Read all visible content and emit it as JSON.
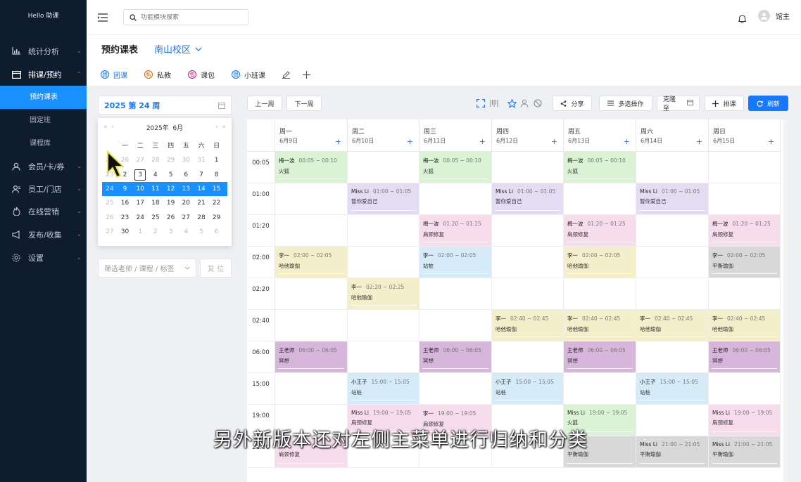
{
  "app": {
    "brand": "Hello 助课"
  },
  "sidebar": {
    "items": [
      {
        "label": "统计分析",
        "icon": "bar-chart-icon"
      },
      {
        "label": "排课/预约",
        "icon": "calendar-icon"
      },
      {
        "label": "会员/卡/券",
        "icon": "member-icon"
      },
      {
        "label": "员工/门店",
        "icon": "staff-icon"
      },
      {
        "label": "在线营销",
        "icon": "fire-icon"
      },
      {
        "label": "发布/收集",
        "icon": "megaphone-icon"
      },
      {
        "label": "设置",
        "icon": "settings-icon"
      }
    ],
    "subitems": [
      {
        "label": "预约课表"
      },
      {
        "label": "固定班"
      },
      {
        "label": "课程库"
      }
    ]
  },
  "header": {
    "search_placeholder": "功能模块搜索",
    "user_name": "馆主"
  },
  "page": {
    "title": "预约课表",
    "campus": "南山校区",
    "tabs": [
      {
        "label": "团课",
        "badge": "团",
        "color": "#1677ff"
      },
      {
        "label": "私教",
        "badge": "私",
        "color": "#d46b08"
      },
      {
        "label": "课包",
        "badge": "包",
        "color": "#c41d7f"
      },
      {
        "label": "小班课",
        "badge": "团",
        "color": "#1677ff"
      }
    ]
  },
  "week_picker": {
    "value": "2025 第 24 周",
    "year": "2025年",
    "month": "6月",
    "weekdays": [
      "一",
      "二",
      "三",
      "四",
      "五",
      "六",
      "日"
    ],
    "rows": [
      {
        "week": "22",
        "days": [
          "26",
          "27",
          "28",
          "29",
          "30",
          "31",
          "1"
        ]
      },
      {
        "week": "23",
        "days": [
          "2",
          "3",
          "4",
          "5",
          "6",
          "7",
          "8"
        ]
      },
      {
        "week": "24",
        "days": [
          "9",
          "10",
          "11",
          "12",
          "13",
          "14",
          "15"
        ]
      },
      {
        "week": "25",
        "days": [
          "16",
          "17",
          "18",
          "19",
          "20",
          "21",
          "22"
        ]
      },
      {
        "week": "26",
        "days": [
          "23",
          "24",
          "25",
          "26",
          "27",
          "28",
          "29"
        ]
      },
      {
        "week": "27",
        "days": [
          "30",
          "1",
          "2",
          "3",
          "4",
          "5",
          "6"
        ]
      }
    ],
    "selected_week": "24",
    "today": "3"
  },
  "filter": {
    "placeholder": "筛选老师 / 课程 / 标签",
    "reset_label": "复 位"
  },
  "toolbar": {
    "prev_week": "上一周",
    "next_week": "下一周",
    "share": "分享",
    "multi_select": "多选操作",
    "clone": "克隆至",
    "add_class": "排课",
    "refresh": "刷新"
  },
  "schedule": {
    "days": [
      {
        "name": "周一",
        "date": "6月9日"
      },
      {
        "name": "周二",
        "date": "6月10日"
      },
      {
        "name": "周三",
        "date": "6月11日"
      },
      {
        "name": "周四",
        "date": "6月12日"
      },
      {
        "name": "周五",
        "date": "6月13日"
      },
      {
        "name": "周六",
        "date": "6月14日"
      },
      {
        "name": "周日",
        "date": "6月15日"
      }
    ],
    "times": [
      "00:05",
      "01:00",
      "01:20",
      "02:00",
      "02:20",
      "02:40",
      "06:00",
      "15:00",
      "19:00",
      "21:00"
    ],
    "events": [
      {
        "day": 0,
        "slot": 0,
        "teacher": "梅一波",
        "time": "00:05 ~ 00:10",
        "course": "火狐",
        "color": "#d9f3d4"
      },
      {
        "day": 2,
        "slot": 0,
        "teacher": "梅一波",
        "time": "00:05 ~ 00:10",
        "course": "火狐",
        "color": "#d9f3d4"
      },
      {
        "day": 4,
        "slot": 0,
        "teacher": "梅一波",
        "time": "00:05 ~ 00:10",
        "course": "火狐",
        "color": "#d9f3d4"
      },
      {
        "day": 1,
        "slot": 1,
        "teacher": "Miss Li",
        "time": "01:00 ~ 01:05",
        "course": "暂你爱自己",
        "color": "#e4dcf3"
      },
      {
        "day": 3,
        "slot": 1,
        "teacher": "Miss Li",
        "time": "01:00 ~ 01:05",
        "course": "暂你爱自己",
        "color": "#e4dcf3"
      },
      {
        "day": 5,
        "slot": 1,
        "teacher": "Miss Li",
        "time": "01:00 ~ 01:05",
        "course": "暂你爱自己",
        "color": "#e4dcf3"
      },
      {
        "day": 2,
        "slot": 2,
        "teacher": "梅一波",
        "time": "01:20 ~ 01:25",
        "course": "肩颈修复",
        "color": "#f7dcec"
      },
      {
        "day": 4,
        "slot": 2,
        "teacher": "梅一波",
        "time": "01:20 ~ 01:25",
        "course": "肩颈修复",
        "color": "#f7dcec"
      },
      {
        "day": 6,
        "slot": 2,
        "teacher": "梅一波",
        "time": "01:20 ~ 01:25",
        "course": "肩颈修复",
        "color": "#f7dcec"
      },
      {
        "day": 0,
        "slot": 3,
        "teacher": "李一",
        "time": "02:00 ~ 02:05",
        "course": "哈他瑜伽",
        "color": "#f4efca"
      },
      {
        "day": 2,
        "slot": 3,
        "teacher": "李一",
        "time": "02:00 ~ 02:05",
        "course": "站桩",
        "color": "#d6ebf8"
      },
      {
        "day": 4,
        "slot": 3,
        "teacher": "李一",
        "time": "02:00 ~ 02:05",
        "course": "哈他瑜伽",
        "color": "#f4efca"
      },
      {
        "day": 6,
        "slot": 3,
        "teacher": "李一",
        "time": "02:00 ~ 02:05",
        "course": "平衡瑜伽",
        "color": "#d8d8d8"
      },
      {
        "day": 1,
        "slot": 4,
        "teacher": "李一",
        "time": "02:20 ~ 02:25",
        "course": "哈他瑜伽",
        "color": "#f4efca"
      },
      {
        "day": 3,
        "slot": 5,
        "teacher": "李一",
        "time": "02:40 ~ 02:45",
        "course": "哈他瑜伽",
        "color": "#f4efca"
      },
      {
        "day": 4,
        "slot": 5,
        "teacher": "李一",
        "time": "02:40 ~ 02:45",
        "course": "哈他瑜伽",
        "color": "#f4efca"
      },
      {
        "day": 5,
        "slot": 5,
        "teacher": "李一",
        "time": "02:40 ~ 02:45",
        "course": "哈他瑜伽",
        "color": "#f4efca"
      },
      {
        "day": 6,
        "slot": 5,
        "teacher": "李一",
        "time": "02:40 ~ 02:45",
        "course": "哈他瑜伽",
        "color": "#f4efca"
      },
      {
        "day": 0,
        "slot": 6,
        "teacher": "王老师",
        "time": "06:00 ~ 06:05",
        "course": "冥想",
        "color": "#d7b6dc"
      },
      {
        "day": 2,
        "slot": 6,
        "teacher": "王老师",
        "time": "06:00 ~ 06:05",
        "course": "冥想",
        "color": "#d7b6dc"
      },
      {
        "day": 4,
        "slot": 6,
        "teacher": "王老师",
        "time": "06:00 ~ 06:05",
        "course": "冥想",
        "color": "#d7b6dc"
      },
      {
        "day": 6,
        "slot": 6,
        "teacher": "王老师",
        "time": "06:00 ~ 06:05",
        "course": "冥想",
        "color": "#d7b6dc"
      },
      {
        "day": 1,
        "slot": 7,
        "teacher": "小王子",
        "time": "15:00 ~ 15:05",
        "course": "站桩",
        "color": "#d6ebf8"
      },
      {
        "day": 3,
        "slot": 7,
        "teacher": "小王子",
        "time": "15:00 ~ 15:05",
        "course": "站桩",
        "color": "#d6ebf8"
      },
      {
        "day": 5,
        "slot": 7,
        "teacher": "小王子",
        "time": "15:00 ~ 15:05",
        "course": "站桩",
        "color": "#d6ebf8"
      },
      {
        "day": 1,
        "slot": 8,
        "teacher": "Miss Li",
        "time": "19:00 ~ 19:05",
        "course": "肩颈修复",
        "color": "#f7dcec"
      },
      {
        "day": 2,
        "slot": 8,
        "teacher": "李一",
        "time": "19:00 ~ 19:05",
        "course": "肩颈修复",
        "color": "#f7dcec"
      },
      {
        "day": 4,
        "slot": 8,
        "teacher": "Miss Li",
        "time": "19:00 ~ 19:05",
        "course": "火狐",
        "color": "#d9f3d4"
      },
      {
        "day": 6,
        "slot": 8,
        "teacher": "Miss Li",
        "time": "19:00 ~ 19:05",
        "course": "肩颈修复",
        "color": "#f7dcec"
      },
      {
        "day": 0,
        "slot": 9,
        "teacher": "",
        "time": "",
        "course": "肩颈修复",
        "color": "#f7dcec"
      },
      {
        "day": 4,
        "slot": 9,
        "teacher": "",
        "time": "21:05",
        "course": "平衡瑜伽",
        "color": "#d8d8d8"
      },
      {
        "day": 5,
        "slot": 9,
        "teacher": "Miss Li",
        "time": "21:00 ~ 21:05",
        "course": "平衡瑜伽",
        "color": "#d8d8d8"
      },
      {
        "day": 6,
        "slot": 9,
        "teacher": "Miss Li",
        "time": "21:00 ~ 21:05",
        "course": "平衡瑜伽",
        "color": "#d8d8d8"
      }
    ]
  },
  "subtitle": "另外新版本还对左侧主菜单进行归纳和分类",
  "colors": {
    "accent": "#1677ff",
    "sidebar_bg": "#0f1c2e",
    "active_item": "#1890ff"
  }
}
